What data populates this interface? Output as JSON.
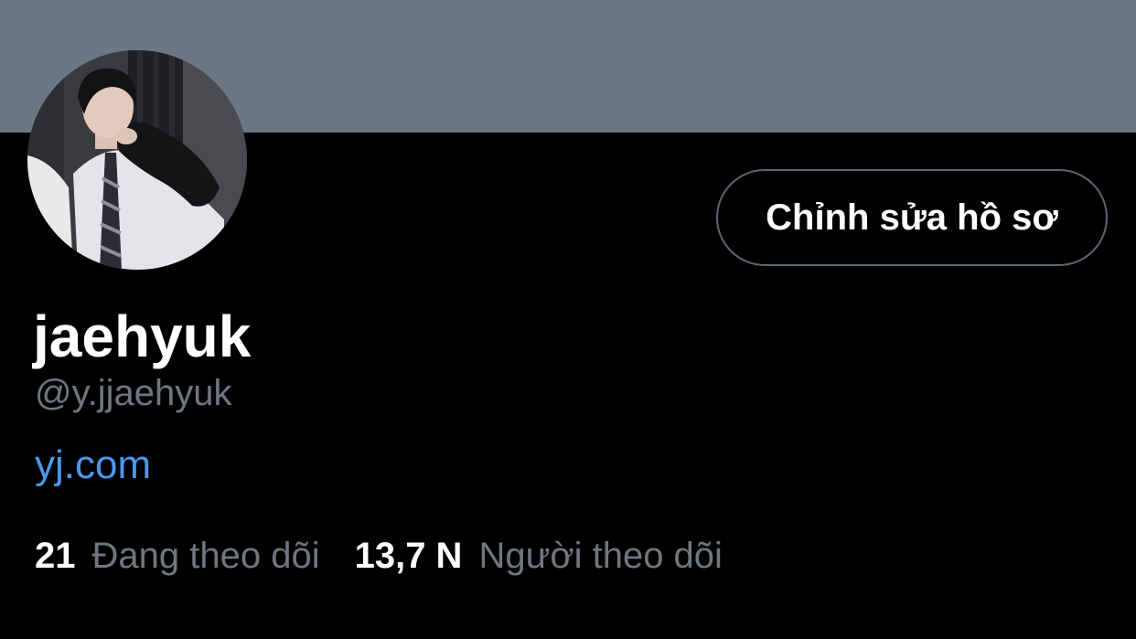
{
  "profile": {
    "display_name": "jaehyuk",
    "handle": "@y.jjaehyuk",
    "website": "yj.com",
    "edit_button_label": "Chỉnh sửa hồ sơ"
  },
  "stats": {
    "following_count": "21",
    "following_label": "Đang theo dõi",
    "followers_count": "13,7 N",
    "followers_label": "Người theo dõi"
  },
  "colors": {
    "banner": "#6b7784",
    "background": "#000000",
    "link": "#4a99e9",
    "secondary_text": "#6e7781",
    "button_border": "#5b6671"
  }
}
